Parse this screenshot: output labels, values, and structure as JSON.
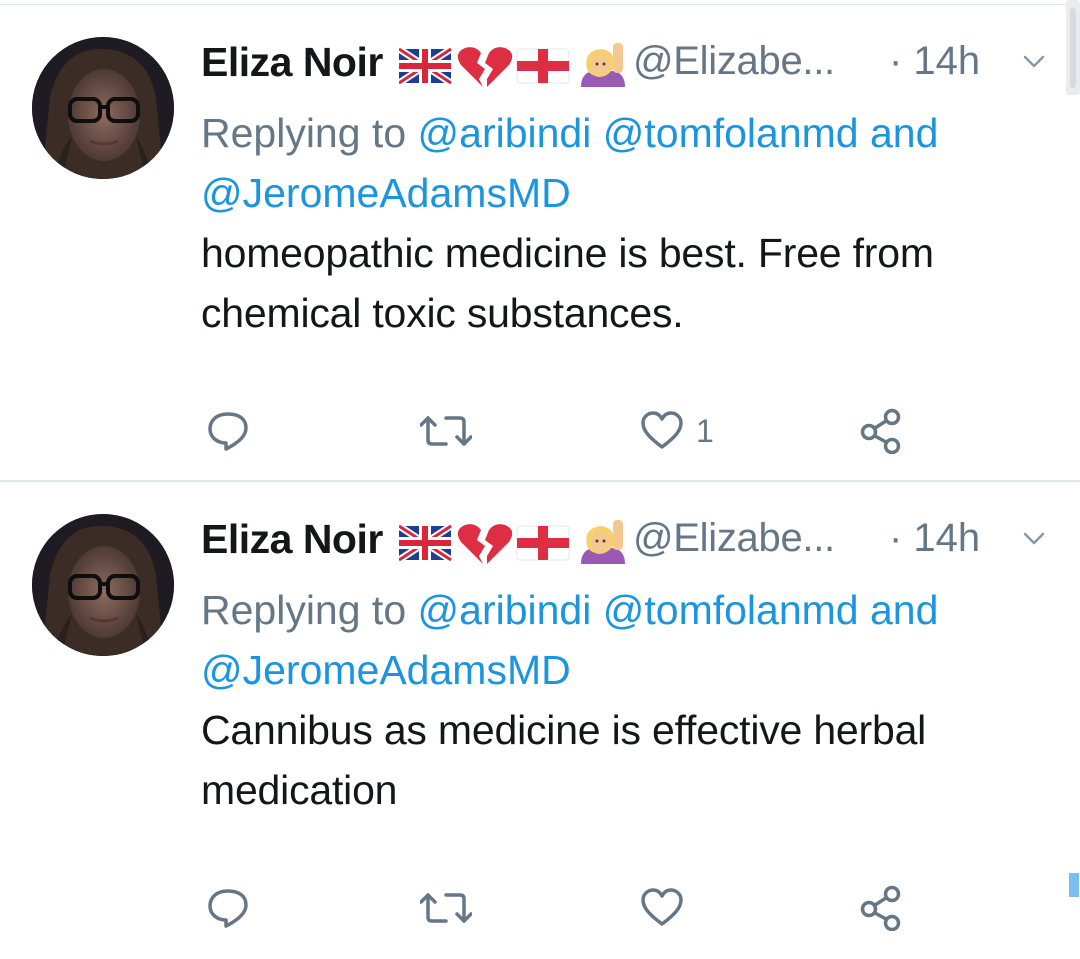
{
  "tweets": [
    {
      "display_name": "Eliza Noir",
      "name_icons": [
        "uk-flag-icon",
        "broken-heart-icon",
        "england-flag-icon",
        "person-raising-hand-icon"
      ],
      "handle": "@Elizabe...",
      "time": "· 14h",
      "replying_prefix": "Replying to",
      "mentions": [
        "@aribindi",
        "@tomfolanmd",
        "@JeromeAdamsMD"
      ],
      "replying_and": "and",
      "text_lines": [
        "homeopathic medicine is best. Free from",
        "chemical toxic substances."
      ],
      "like_count": "1"
    },
    {
      "display_name": "Eliza Noir",
      "name_icons": [
        "uk-flag-icon",
        "broken-heart-icon",
        "england-flag-icon",
        "person-raising-hand-icon"
      ],
      "handle": "@Elizabe...",
      "time": "· 14h",
      "replying_prefix": "Replying to",
      "mentions": [
        "@aribindi",
        "@tomfolanmd",
        "@JeromeAdamsMD"
      ],
      "replying_and": "and",
      "text_lines": [
        "Cannibus as medicine is effective herbal",
        "medication"
      ],
      "like_count": ""
    }
  ],
  "colors": {
    "text": "#14171a",
    "secondary": "#657786",
    "link": "#1b95e0",
    "divider": "#e1e8ed"
  }
}
